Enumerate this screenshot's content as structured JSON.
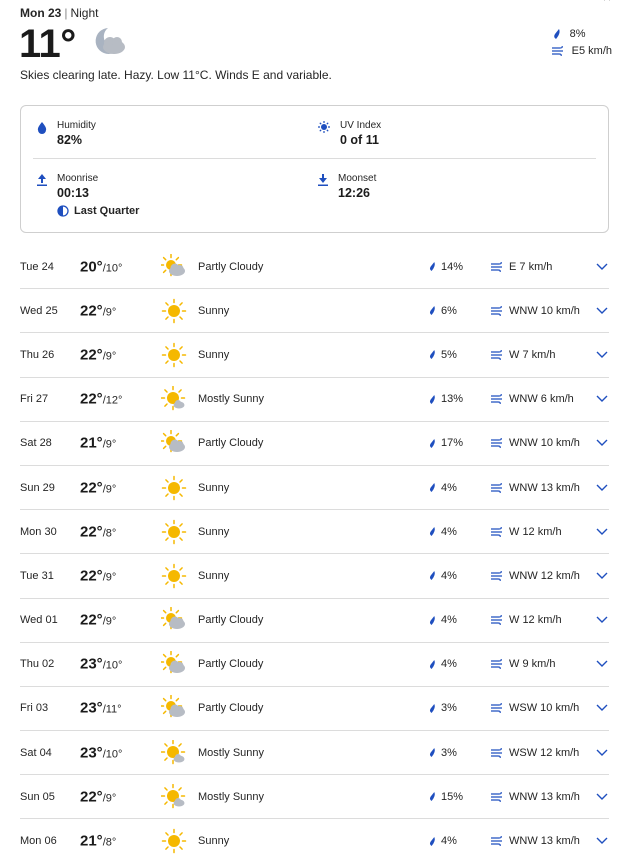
{
  "current": {
    "day_label": "Mon 23",
    "period": "Night",
    "temperature": "11°",
    "precip": "8%",
    "wind": "E5 km/h",
    "summary": "Skies clearing late. Hazy. Low 11°C. Winds E and variable."
  },
  "details": {
    "humidity_label": "Humidity",
    "humidity_value": "82%",
    "uv_label": "UV Index",
    "uv_value": "0 of 11",
    "moonrise_label": "Moonrise",
    "moonrise_value": "00:13",
    "moonset_label": "Moonset",
    "moonset_value": "12:26",
    "moon_phase": "Last Quarter"
  },
  "colors": {
    "accent": "#1f4fbf",
    "sun": "#f5b800",
    "cloud": "#b7bcc4",
    "moon": "#a9b3c1",
    "divider": "#dcdcdc"
  },
  "days": [
    {
      "date": "Tue 24",
      "hi": "20°",
      "lo": "10°",
      "icon": "partly-cloudy",
      "phrase": "Partly Cloudy",
      "precip": "14%",
      "wind": "E 7 km/h"
    },
    {
      "date": "Wed 25",
      "hi": "22°",
      "lo": "9°",
      "icon": "sunny",
      "phrase": "Sunny",
      "precip": "6%",
      "wind": "WNW 10 km/h"
    },
    {
      "date": "Thu 26",
      "hi": "22°",
      "lo": "9°",
      "icon": "sunny",
      "phrase": "Sunny",
      "precip": "5%",
      "wind": "W 7 km/h"
    },
    {
      "date": "Fri 27",
      "hi": "22°",
      "lo": "12°",
      "icon": "mostly-sunny",
      "phrase": "Mostly Sunny",
      "precip": "13%",
      "wind": "WNW 6 km/h"
    },
    {
      "date": "Sat 28",
      "hi": "21°",
      "lo": "9°",
      "icon": "partly-cloudy",
      "phrase": "Partly Cloudy",
      "precip": "17%",
      "wind": "WNW 10 km/h"
    },
    {
      "date": "Sun 29",
      "hi": "22°",
      "lo": "9°",
      "icon": "sunny",
      "phrase": "Sunny",
      "precip": "4%",
      "wind": "WNW 13 km/h"
    },
    {
      "date": "Mon 30",
      "hi": "22°",
      "lo": "8°",
      "icon": "sunny",
      "phrase": "Sunny",
      "precip": "4%",
      "wind": "W 12 km/h"
    },
    {
      "date": "Tue 31",
      "hi": "22°",
      "lo": "9°",
      "icon": "sunny",
      "phrase": "Sunny",
      "precip": "4%",
      "wind": "WNW 12 km/h"
    },
    {
      "date": "Wed 01",
      "hi": "22°",
      "lo": "9°",
      "icon": "partly-cloudy",
      "phrase": "Partly Cloudy",
      "precip": "4%",
      "wind": "W 12 km/h"
    },
    {
      "date": "Thu 02",
      "hi": "23°",
      "lo": "10°",
      "icon": "partly-cloudy",
      "phrase": "Partly Cloudy",
      "precip": "4%",
      "wind": "W 9 km/h"
    },
    {
      "date": "Fri 03",
      "hi": "23°",
      "lo": "11°",
      "icon": "partly-cloudy",
      "phrase": "Partly Cloudy",
      "precip": "3%",
      "wind": "WSW 10 km/h"
    },
    {
      "date": "Sat 04",
      "hi": "23°",
      "lo": "10°",
      "icon": "mostly-sunny",
      "phrase": "Mostly Sunny",
      "precip": "3%",
      "wind": "WSW 12 km/h"
    },
    {
      "date": "Sun 05",
      "hi": "22°",
      "lo": "9°",
      "icon": "mostly-sunny",
      "phrase": "Mostly Sunny",
      "precip": "15%",
      "wind": "WNW 13 km/h"
    },
    {
      "date": "Mon 06",
      "hi": "21°",
      "lo": "8°",
      "icon": "sunny",
      "phrase": "Sunny",
      "precip": "4%",
      "wind": "WNW 13 km/h"
    }
  ]
}
